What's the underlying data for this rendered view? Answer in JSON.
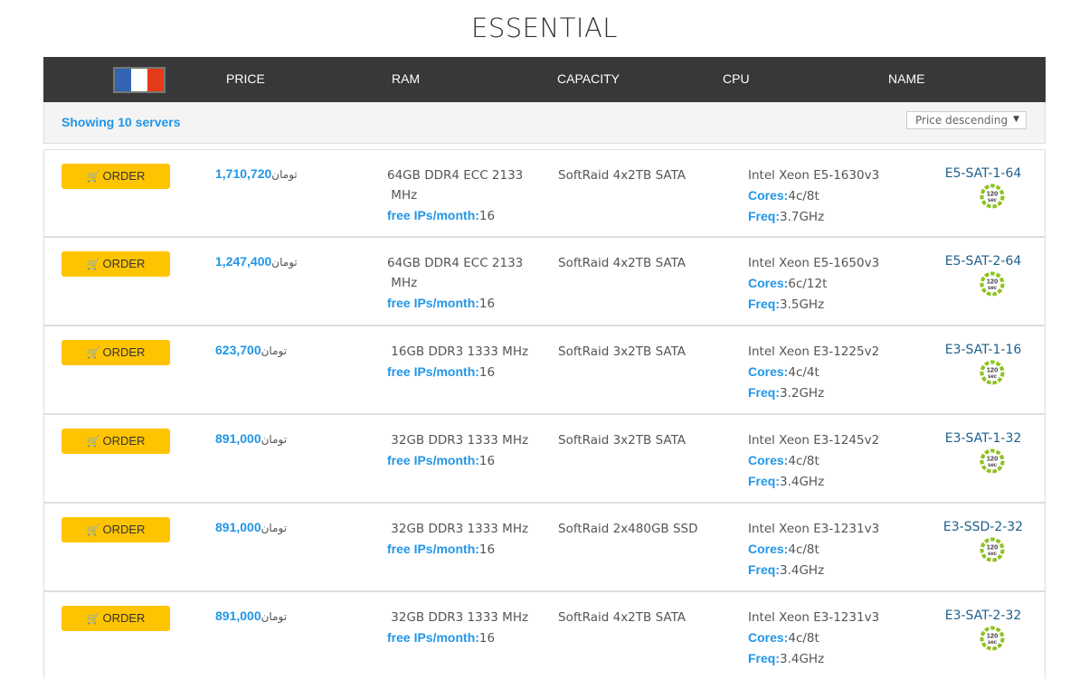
{
  "page": {
    "title": "ESSENTIAL"
  },
  "header": {
    "flag": {
      "name": "france-flag",
      "colors": [
        "#3465b4",
        "#ffffff",
        "#e63b18"
      ]
    },
    "columns": [
      "PRICE",
      "RAM",
      "CAPACITY",
      "CPU",
      "NAME"
    ]
  },
  "toolbar": {
    "showing_text": "Showing 10 servers",
    "sort": {
      "selected": "Price descending"
    }
  },
  "labels": {
    "order": "ORDER",
    "currency": "تومان",
    "free_ips": "free IPs/month:",
    "cores": "Cores:",
    "freq": "Freq:",
    "badge_top": "120",
    "badge_bottom": "sec"
  },
  "colors": {
    "accent_blue": "#2196e8",
    "order_yellow": "#ffc400",
    "header_dark": "#383838",
    "badge_green": "#8dc21f"
  },
  "servers": [
    {
      "price": "1,710,720",
      "ram_lines": [
        "64GB DDR4 ECC 2133",
        " MHz"
      ],
      "free_ips": "16",
      "capacity": "SoftRaid 4x2TB SATA",
      "cpu": "Intel Xeon E5-1630v3",
      "cores": "4c/8t",
      "freq": "3.7GHz",
      "name": "E5-SAT-1-64"
    },
    {
      "price": "1,247,400",
      "ram_lines": [
        "64GB DDR4 ECC 2133",
        " MHz"
      ],
      "free_ips": "16",
      "capacity": "SoftRaid 4x2TB SATA",
      "cpu": "Intel Xeon E5-1650v3",
      "cores": "6c/12t",
      "freq": "3.5GHz",
      "name": "E5-SAT-2-64"
    },
    {
      "price": "623,700",
      "ram_lines": [
        " 16GB DDR3 1333 MHz"
      ],
      "free_ips": "16",
      "capacity": "SoftRaid 3x2TB SATA",
      "cpu": "Intel Xeon E3-1225v2",
      "cores": "4c/4t",
      "freq": "3.2GHz",
      "name": "E3-SAT-1-16"
    },
    {
      "price": "891,000",
      "ram_lines": [
        " 32GB DDR3 1333 MHz"
      ],
      "free_ips": "16",
      "capacity": "SoftRaid 3x2TB SATA",
      "cpu": "Intel Xeon E3-1245v2",
      "cores": "4c/8t",
      "freq": "3.4GHz",
      "name": "E3-SAT-1-32"
    },
    {
      "price": "891,000",
      "ram_lines": [
        " 32GB DDR3 1333 MHz"
      ],
      "free_ips": "16",
      "capacity": "SoftRaid 2x480GB SSD",
      "cpu": "Intel Xeon E3-1231v3",
      "cores": "4c/8t",
      "freq": "3.4GHz",
      "name": "E3-SSD-2-32"
    },
    {
      "price": "891,000",
      "ram_lines": [
        " 32GB DDR3 1333 MHz"
      ],
      "free_ips": "16",
      "capacity": "SoftRaid 4x2TB SATA",
      "cpu": "Intel Xeon E3-1231v3",
      "cores": "4c/8t",
      "freq": "3.4GHz",
      "name": "E3-SAT-2-32"
    }
  ]
}
